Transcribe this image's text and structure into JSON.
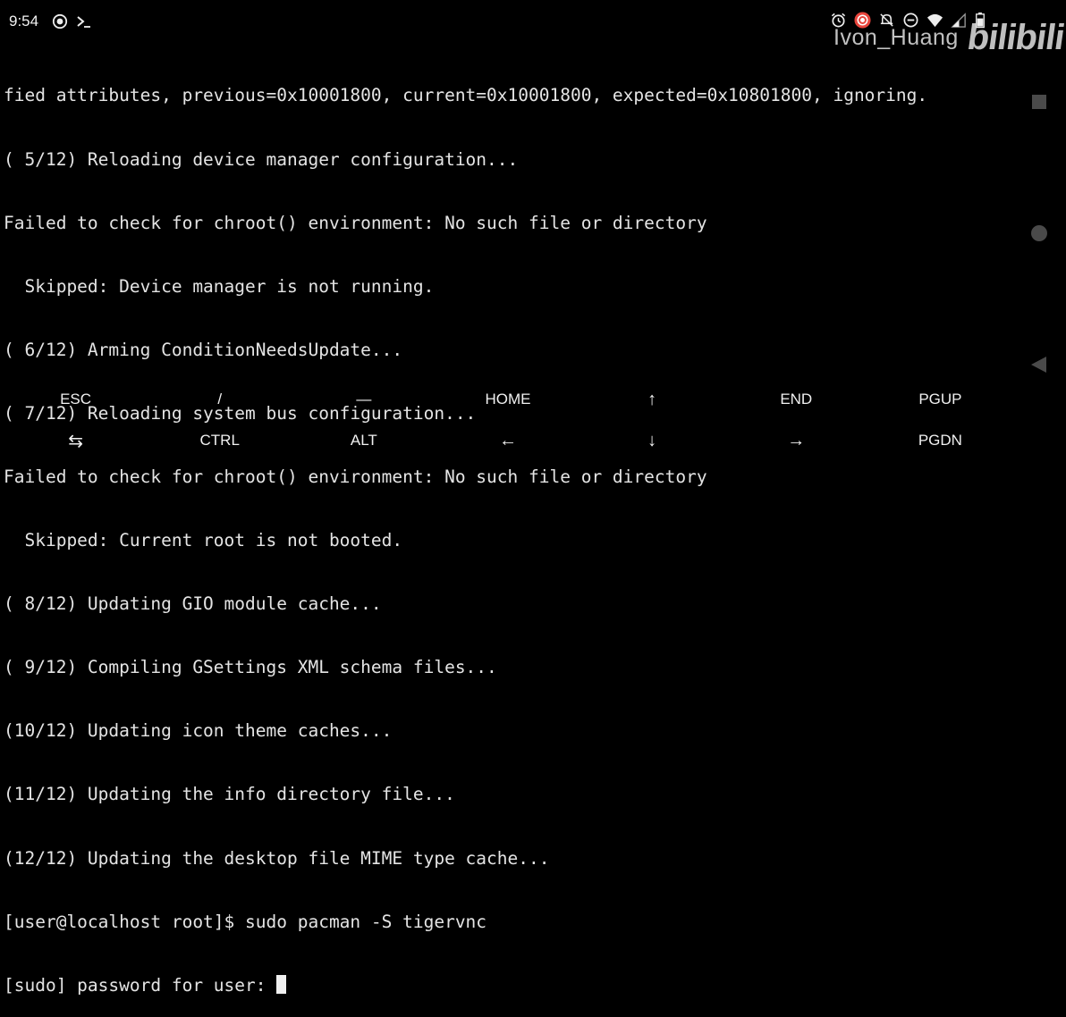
{
  "status_bar": {
    "time": "9:54",
    "left_icons": [
      "record-icon",
      "terminal-icon"
    ],
    "right_icons": [
      "alarm-icon",
      "screen-record-icon",
      "mute-icon",
      "dnd-icon",
      "wifi-icon",
      "signal-icon",
      "battery-icon"
    ]
  },
  "watermark": {
    "user": "Ivon_Huang",
    "logo": "bilibili"
  },
  "terminal": {
    "lines": [
      "fied attributes, previous=0x10001800, current=0x10001800, expected=0x10801800, ignoring.",
      "( 5/12) Reloading device manager configuration...",
      "Failed to check for chroot() environment: No such file or directory",
      "  Skipped: Device manager is not running.",
      "( 6/12) Arming ConditionNeedsUpdate...",
      "( 7/12) Reloading system bus configuration...",
      "Failed to check for chroot() environment: No such file or directory",
      "  Skipped: Current root is not booted.",
      "( 8/12) Updating GIO module cache...",
      "( 9/12) Compiling GSettings XML schema files...",
      "(10/12) Updating icon theme caches...",
      "(11/12) Updating the info directory file...",
      "(12/12) Updating the desktop file MIME type cache...",
      "[user@localhost root]$ sudo pacman -S tigervnc",
      "[sudo] password for user: "
    ]
  },
  "extra_keys": {
    "row1": [
      "ESC",
      "/",
      "—",
      "HOME",
      "↑",
      "END",
      "PGUP"
    ],
    "row2": [
      "⇆",
      "CTRL",
      "ALT",
      "←",
      "↓",
      "→",
      "PGDN"
    ]
  },
  "colors": {
    "background": "#000000",
    "text": "#e4e4e4",
    "record_red": "#e8453c"
  }
}
